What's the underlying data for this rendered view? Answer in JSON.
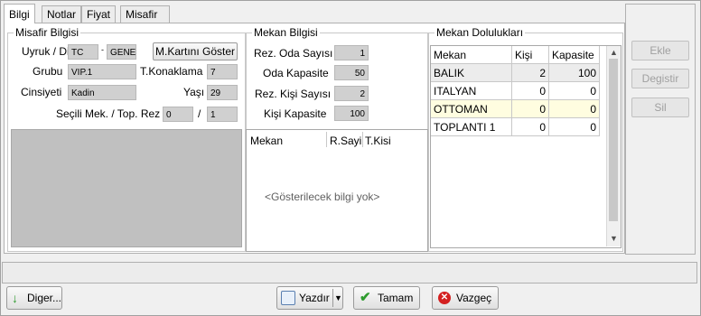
{
  "tabs": [
    "Bilgi",
    "Notlar",
    "Fiyat",
    "Misafir Grupları"
  ],
  "guest_info": {
    "title": "Misafir Bilgisi",
    "nationality_label": "Uyruk / Dil",
    "nationality": "TC",
    "dash": "-",
    "language": "GENEL",
    "card_button": "M.Kartını Göster",
    "group_label": "Grubu",
    "group": "VIP.1",
    "stay_label": "T.Konaklama",
    "stay": "7",
    "gender_label": "Cinsiyeti",
    "gender": "Kadin",
    "age_label": "Yaşı",
    "age": "29",
    "selected_label": "Seçili Mek. / Top. Rez",
    "selected": "0",
    "slash": "/",
    "total": "1"
  },
  "venue_info": {
    "title": "Mekan Bilgisi",
    "res_rooms_label": "Rez. Oda Sayısı",
    "res_rooms": "1",
    "room_capacity_label": "Oda Kapasite",
    "room_capacity": "50",
    "res_persons_label": "Rez. Kişi Sayısı",
    "res_persons": "2",
    "person_capacity_label": "Kişi Kapasite",
    "person_capacity": "100",
    "table_headers": [
      "Mekan",
      "R.Sayi",
      "T.Kisi"
    ],
    "empty_text": "<Gösterilecek bilgi yok>"
  },
  "occupancy": {
    "title": "Mekan Dolulukları",
    "headers": [
      "Mekan",
      "Kişi",
      "Kapasite"
    ],
    "rows": [
      {
        "name": "BALIK",
        "persons": "2",
        "capacity": "100"
      },
      {
        "name": "ITALYAN",
        "persons": "0",
        "capacity": "0"
      },
      {
        "name": "OTTOMAN",
        "persons": "0",
        "capacity": "0"
      },
      {
        "name": "TOPLANTI 1",
        "persons": "0",
        "capacity": "0"
      }
    ]
  },
  "side_buttons": [
    "Ekle",
    "Degistir",
    "Sil"
  ],
  "bottom": {
    "other": "Diger...",
    "print": "Yazdır",
    "ok": "Tamam",
    "cancel": "Vazgeç"
  },
  "colors": {
    "field_bg": "#d0d0d0",
    "highlight_row": "#fffde0",
    "ok_green": "#2e9b2e",
    "cancel_red": "#d42020"
  }
}
